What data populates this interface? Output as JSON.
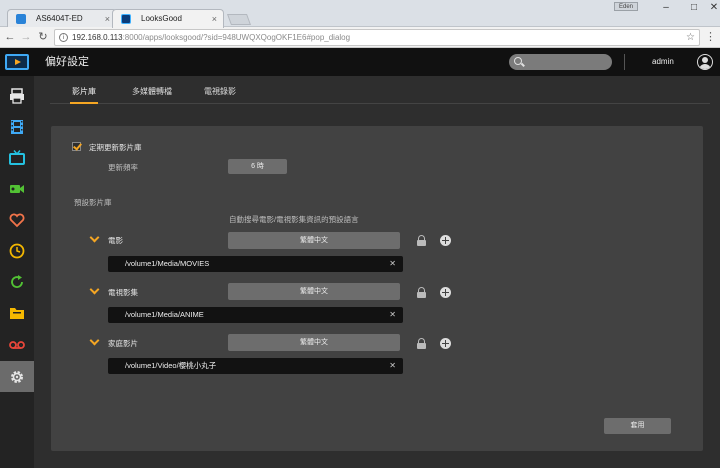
{
  "browser": {
    "tabs": [
      {
        "title": "AS6404T-ED",
        "close": "×"
      },
      {
        "title": "LooksGood",
        "close": "×"
      }
    ],
    "window_user": "Eden",
    "window_controls": {
      "minimize": "–",
      "maximize": "□",
      "close": "✕"
    },
    "url_host": "192.168.0.113",
    "url_rest": ":8000/apps/looksgood/?sid=948UWQXQogOKF1E6#pop_dialog",
    "nav": {
      "back": "←",
      "forward": "→",
      "reload": "↻"
    },
    "star": "☆",
    "menu": "⋮"
  },
  "header": {
    "title": "偏好設定",
    "search_placeholder": "",
    "user": "admin"
  },
  "sidebar": {
    "items": [
      {
        "icon": "printer-icon"
      },
      {
        "icon": "film-icon"
      },
      {
        "icon": "tv-icon"
      },
      {
        "icon": "camcorder-icon"
      },
      {
        "icon": "heart-icon"
      },
      {
        "icon": "clock-icon"
      },
      {
        "icon": "refresh-icon"
      },
      {
        "icon": "folder-icon"
      },
      {
        "icon": "tape-icon"
      },
      {
        "icon": "gear-icon",
        "active": true
      }
    ]
  },
  "subtabs": [
    "影片庫",
    "多媒體轉檔",
    "電視錄影"
  ],
  "settings": {
    "auto_update_label": "定期更新影片庫",
    "auto_update_checked": true,
    "freq_label": "更新頻率",
    "freq_value": "6 時",
    "default_lib_label": "預設影片庫",
    "lang_header": "自動搜尋電影/電視影集資訊的預設語言",
    "libraries": [
      {
        "name": "電影",
        "lang": "繁體中文",
        "path": "/volume1/Media/MOVIES"
      },
      {
        "name": "電視影集",
        "lang": "繁體中文",
        "path": "/volume1/Media/ANIME"
      },
      {
        "name": "家庭影片",
        "lang": "繁體中文",
        "path": "/volume1/Video/櫻桃小丸子"
      }
    ],
    "clear_symbol": "✕",
    "apply_label": "套用"
  }
}
